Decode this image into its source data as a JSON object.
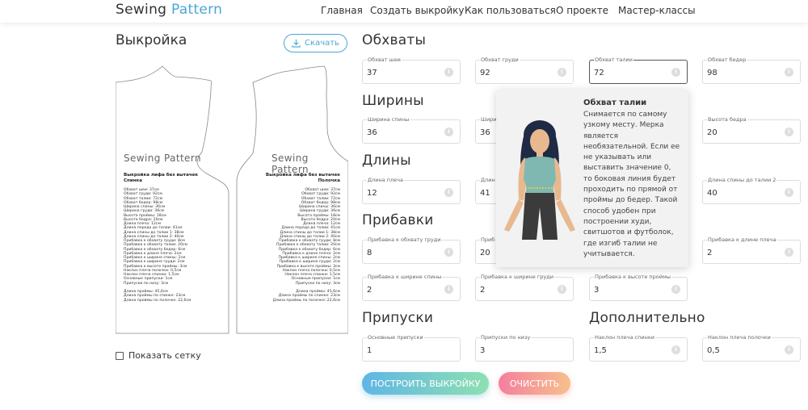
{
  "header": {
    "logo_part1": "Sewing",
    "logo_part2": "Pattern",
    "nav": [
      "Главная",
      "Создать выкройку",
      "Как пользоваться",
      "О проекте",
      "Мастер-классы"
    ]
  },
  "left": {
    "title": "Выкройка",
    "download_label": "Скачать",
    "show_grid_label": "Показать сетку",
    "pattern": {
      "watermark": "Sewing Pattern",
      "back_title": "Выкройка лифа без вытачек\nСпинка",
      "front_title": "Выкройка лифа без вытачек\nПолочка",
      "back_lines": "Обхват шеи: 37см\nОбхват груди: 92см\nОбхват талии: 72см\nОбхват бедер: 98см\nШирина спины: 36см\nШирина груди: 36см\nВысота проймы: 18см\nВысота бедра: 20см\nДлина плеча: 12см\nДлина переда до талии: 41см\nДлина спины до талии 1: 38см\nДлина спины до талии 2: 40см\nПрибавка к обхвату груди: 8см\nПрибавка к обхвату талии: 20см\nПрибавка к обхвату бедер: 6см\nПрибавка к длине плеча: 2см\nПрибавка к ширине спины: 2см\nПрибавка к ширине груди: 2см\nПрибавка к высоте проймы: 3см\nНаклон плеча полочки: 0,5см\nНаклон плеча спинки: 1,5см\nОсновные припуски: 1см\nПрипуски по низу: 3см\n\nДлина проймы: 45,6см\nДлина проймы по спинке: 23см\nДлина проймы по полочке: 22,6см",
      "front_lines": "Обхват шеи: 37см\nОбхват груди: 92см\nОбхват талии: 72см\nОбхват бедер: 98см\nШирина спины: 36см\nШирина груди: 36см\nВысота проймы: 18см\nВысота бедра: 20см\nДлина плеча: 12см\nДлина переда до талии: 41см\nДлина спины до талии 1: 38см\nДлина спины до талии 2: 40см\nПрибавка к обхвату груди: 8см\nПрибавка к обхвату талии: 20см\nПрибавка к обхвату бедер: 6см\nПрибавка к длине плеча: 2см\nПрибавка к ширине спины: 2см\nПрибавка к ширине груди: 2см\nПрибавка к высоте проймы: 3см\nНаклон плеча полочки: 0,5см\nНаклон плеча спинки: 1,5см\nОсновные припуски: 1см\nПрипуски по низу: 3см\n\nДлина проймы: 45,6см\nДлина проймы по спинке: 23см\nДлина проймы по полочке: 22,6см"
    }
  },
  "sections": {
    "girths": "Обхваты",
    "widths": "Ширины",
    "lengths": "Длины",
    "allowances": "Прибавки",
    "seams": "Припуски",
    "extra": "Дополнительно"
  },
  "fields": {
    "neck": {
      "label": "Обхват шеи",
      "value": "37"
    },
    "chest": {
      "label": "Обхват груди",
      "value": "92"
    },
    "waist": {
      "label": "Обхват талии",
      "value": "72"
    },
    "hips": {
      "label": "Обхват бедер",
      "value": "98"
    },
    "back_width": {
      "label": "Ширина спины",
      "value": "36"
    },
    "chest_width": {
      "label": "Ширин",
      "value": "36"
    },
    "hip_height": {
      "label": "Высота бедра",
      "value": "20"
    },
    "shoulder_len": {
      "label": "Длина плеча",
      "value": "12"
    },
    "front_len": {
      "label": "Длин",
      "value": "41"
    },
    "back_len2": {
      "label": "Длина спины до талии 2",
      "value": "40"
    },
    "add_chest": {
      "label": "Прибавка к обхвату груди",
      "value": "8"
    },
    "add_waist": {
      "label": "Приб",
      "value": "20"
    },
    "add_shoulder": {
      "label": "Прибавка к длине плеча",
      "value": "2"
    },
    "add_back": {
      "label": "Прибавка к ширине спины",
      "value": "2"
    },
    "add_chest_w": {
      "label": "Прибавка к ширине груди",
      "value": "2"
    },
    "add_armhole": {
      "label": "Прибавка к высоте проймы",
      "value": "3"
    },
    "seam_main": {
      "label": "Основные припуски",
      "value": "1"
    },
    "seam_bottom": {
      "label": "Припуски по низу",
      "value": "3"
    },
    "tilt_back": {
      "label": "Наклон плеча спинки",
      "value": "1,5"
    },
    "tilt_front": {
      "label": "Наклон плеча полочки",
      "value": "0,5"
    }
  },
  "tooltip": {
    "title": "Обхват талии",
    "text": "Снимается по самому узкому месту. Мерка является необязательной. Если ее не указывать или выставить значение 0, то боковая линия будет проходить по прямой от проймы до бедер. Такой способ удобен при построении худи, свитшотов и футболок, где изгиб талии не учитывается."
  },
  "buttons": {
    "build": "ПОСТРОИТЬ ВЫКРОЙКУ",
    "clear": "ОЧИСТИТЬ"
  },
  "colors": {
    "accent": "#4aa7d8",
    "build_gradient": [
      "#5fb6e6",
      "#8ee0b0"
    ],
    "clear_gradient": [
      "#f47fa0",
      "#f7c08c"
    ]
  }
}
